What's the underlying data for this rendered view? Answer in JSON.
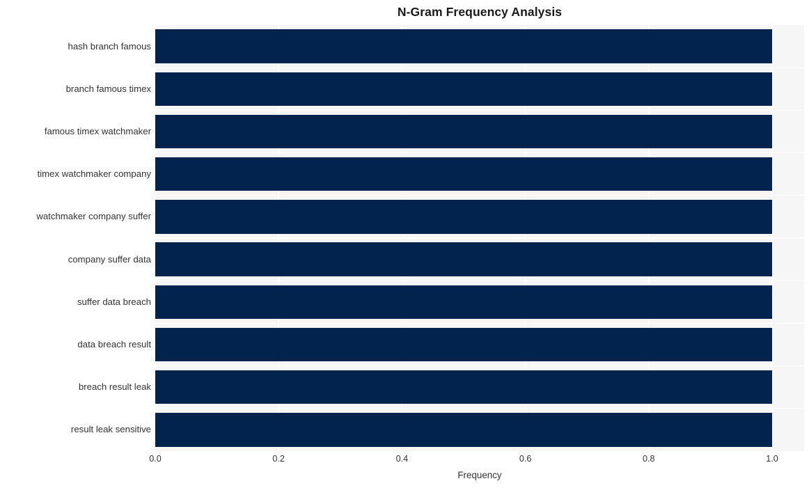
{
  "chart_data": {
    "type": "bar",
    "orientation": "horizontal",
    "title": "N-Gram Frequency Analysis",
    "xlabel": "Frequency",
    "ylabel": "",
    "categories": [
      "hash branch famous",
      "branch famous timex",
      "famous timex watchmaker",
      "timex watchmaker company",
      "watchmaker company suffer",
      "company suffer data",
      "suffer data breach",
      "data breach result",
      "breach result leak",
      "result leak sensitive"
    ],
    "values": [
      1.0,
      1.0,
      1.0,
      1.0,
      1.0,
      1.0,
      1.0,
      1.0,
      1.0,
      1.0
    ],
    "xlim": [
      0.0,
      1.0
    ],
    "xticks": [
      "0.0",
      "0.2",
      "0.4",
      "0.6",
      "0.8",
      "1.0"
    ],
    "xtick_values": [
      0.0,
      0.2,
      0.4,
      0.6,
      0.8,
      1.0
    ],
    "grid": true,
    "legend": null,
    "bar_color": "#03234f",
    "plot_background": "#f6f6f7",
    "figure_background": "#ffffff",
    "text_color": "#333333",
    "title_color": "#1a1a1a"
  }
}
